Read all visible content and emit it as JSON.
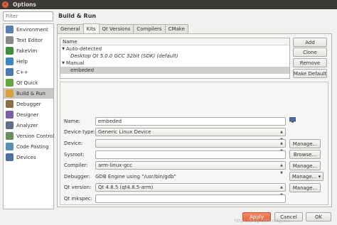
{
  "window": {
    "title": "Options"
  },
  "filter": {
    "placeholder": "Filter"
  },
  "sidebar": {
    "items": [
      {
        "label": "Environment",
        "icon": "monitor-icon",
        "color": "#5a7fb5"
      },
      {
        "label": "Text Editor",
        "icon": "text-editor-icon",
        "color": "#8a8a8a"
      },
      {
        "label": "FakeVim",
        "icon": "fakevim-icon",
        "color": "#3f8f3f"
      },
      {
        "label": "Help",
        "icon": "help-icon",
        "color": "#3c86c6"
      },
      {
        "label": "C++",
        "icon": "cpp-icon",
        "color": "#4a7ab0"
      },
      {
        "label": "Qt Quick",
        "icon": "qt-quick-icon",
        "color": "#62a83a"
      },
      {
        "label": "Build & Run",
        "icon": "build-run-icon",
        "color": "#d9a135"
      },
      {
        "label": "Debugger",
        "icon": "debugger-icon",
        "color": "#8a6d4a"
      },
      {
        "label": "Designer",
        "icon": "designer-icon",
        "color": "#7a5fa8"
      },
      {
        "label": "Analyzer",
        "icon": "analyzer-icon",
        "color": "#5f6f88"
      },
      {
        "label": "Version Control",
        "icon": "version-control-icon",
        "color": "#6b8e5a"
      },
      {
        "label": "Code Pasting",
        "icon": "code-pasting-icon",
        "color": "#5a8fb5"
      },
      {
        "label": "Devices",
        "icon": "devices-icon",
        "color": "#4f6fa0"
      }
    ],
    "selected_index": 6
  },
  "page": {
    "title": "Build & Run"
  },
  "tabs": [
    "General",
    "Kits",
    "Qt Versions",
    "Compilers",
    "CMake"
  ],
  "active_tab": "Kits",
  "kits_tree": {
    "header": "Name",
    "auto_label": "Auto-detected",
    "auto_kit": "Desktop Qt 5.0.0 GCC 32bit (SDK) (default)",
    "manual_label": "Manual",
    "manual_kit": "embeded"
  },
  "buttons": {
    "add": "Add",
    "clone": "Clone",
    "remove": "Remove",
    "make_default": "Make Default",
    "manage": "Manage...",
    "browse": "Browse...",
    "manage_menu": "Manage... ▾",
    "apply": "Apply",
    "cancel": "Cancel",
    "ok": "OK"
  },
  "form": {
    "name_label": "Name:",
    "name_value": "embeded",
    "device_type_label": "Device type:",
    "device_type_value": "Generic Linux Device",
    "device_label": "Device:",
    "device_value": "",
    "sysroot_label": "Sysroot:",
    "sysroot_value": "",
    "compiler_label": "Compiler:",
    "compiler_value": "arm-linux-gcc",
    "debugger_label": "Debugger:",
    "debugger_value": "GDB Engine using \"/usr/bin/gdb\"",
    "qt_version_label": "Qt version:",
    "qt_version_value": "Qt 4.8.5 (qt4.8.5-arm)",
    "qt_mkspec_label": "Qt mkspec:",
    "qt_mkspec_value": ""
  },
  "watermark": "https://blog.csdn.net/jenie",
  "colors": {
    "titlebar": "#3b3a36",
    "close": "#e65c3a",
    "apply": "#e8643c",
    "selected": "#c7c6c2"
  }
}
